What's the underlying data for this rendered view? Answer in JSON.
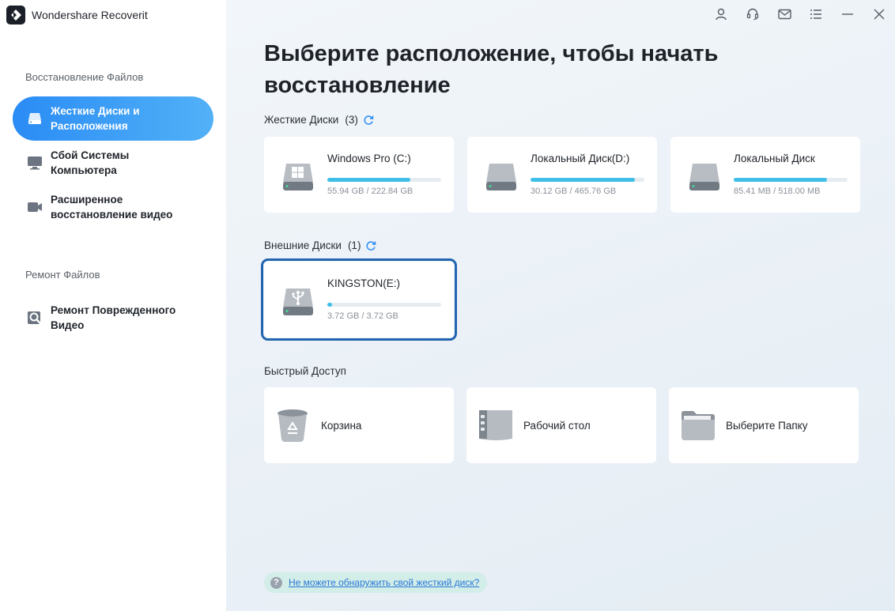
{
  "app": {
    "title": "Wondershare Recoverit"
  },
  "sidebar": {
    "section_recovery": "Восстановление Файлов",
    "section_repair": "Ремонт Файлов",
    "items": [
      {
        "label": "Жесткие Диски и Расположения",
        "active": true,
        "icon": "hard-drive-icon"
      },
      {
        "label": "Сбой Системы Компьютера",
        "active": false,
        "icon": "computer-icon"
      },
      {
        "label": "Расширенное восстановление видео",
        "active": false,
        "icon": "video-camera-icon"
      },
      {
        "label": "Ремонт Поврежденного Видео",
        "active": false,
        "icon": "video-repair-icon"
      }
    ]
  },
  "topbar": {
    "icons": [
      "user-icon",
      "support-headset-icon",
      "mail-icon",
      "menu-icon",
      "minimize-icon",
      "close-icon"
    ]
  },
  "main": {
    "title": "Выберите расположение, чтобы начать восстановление",
    "hard_drives": {
      "label": "Жесткие Диски",
      "count": "(3)",
      "drives": [
        {
          "name": "Windows Pro (C:)",
          "size": "55.94 GB / 222.84 GB",
          "used_fraction": 0.73,
          "icon": "windows-drive-icon"
        },
        {
          "name": "Локальный Диск(D:)",
          "size": "30.12 GB / 465.76 GB",
          "used_fraction": 0.92,
          "icon": "hard-drive-icon"
        },
        {
          "name": "Локальный Диск",
          "size": "85.41 MB / 518.00 MB",
          "used_fraction": 0.82,
          "icon": "hard-drive-icon"
        }
      ]
    },
    "external_drives": {
      "label": "Внешние Диски",
      "count": "(1)",
      "drives": [
        {
          "name": "KINGSTON(E:)",
          "size": "3.72 GB / 3.72 GB",
          "used_fraction": 0.04,
          "icon": "usb-drive-icon",
          "selected": true
        }
      ]
    },
    "quick_access": {
      "label": "Быстрый Доступ",
      "items": [
        {
          "label": "Корзина",
          "icon": "recycle-bin-icon"
        },
        {
          "label": "Рабочий стол",
          "icon": "desktop-icon"
        },
        {
          "label": "Выберите Папку",
          "icon": "folder-icon"
        }
      ]
    },
    "help_link": "Не можете обнаружить свой жесткий диск?"
  },
  "colors": {
    "accent": "#2a8cf5",
    "progress": "#3fbfe8",
    "selected_border": "#2364b0",
    "help_bg": "#d3ede8"
  }
}
